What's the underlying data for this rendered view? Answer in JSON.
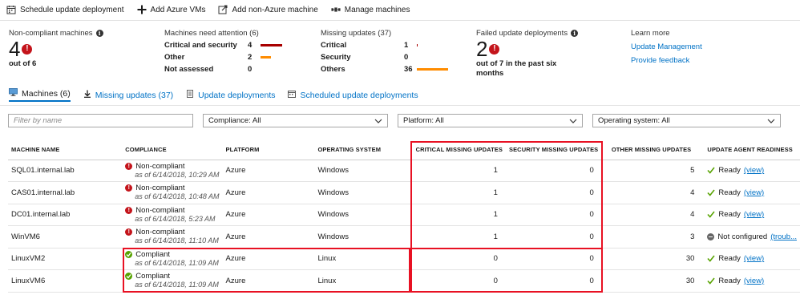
{
  "toolbar": {
    "schedule_label": "Schedule update deployment",
    "add_azure_label": "Add Azure VMs",
    "add_non_azure_label": "Add non-Azure machine",
    "manage_label": "Manage machines"
  },
  "summary": {
    "noncompliant": {
      "title": "Non-compliant machines",
      "value": "4",
      "sub": "out of 6"
    },
    "attention": {
      "title": "Machines need attention (6)",
      "rows": [
        {
          "label": "Critical and security",
          "value": "4",
          "bar_fraction": 0.67,
          "bar_color": "#a80000"
        },
        {
          "label": "Other",
          "value": "2",
          "bar_fraction": 0.33,
          "bar_color": "#ff8c00"
        },
        {
          "label": "Not assessed",
          "value": "0",
          "bar_fraction": 0,
          "bar_color": "#ff8c00"
        }
      ]
    },
    "missing": {
      "title": "Missing updates (37)",
      "rows": [
        {
          "label": "Critical",
          "value": "1",
          "bar_fraction": 0.03,
          "bar_color": "#a80000"
        },
        {
          "label": "Security",
          "value": "0",
          "bar_fraction": 0,
          "bar_color": "#a80000"
        },
        {
          "label": "Others",
          "value": "36",
          "bar_fraction": 0.97,
          "bar_color": "#ff8c00"
        }
      ]
    },
    "failed": {
      "title": "Failed update deployments",
      "value": "2",
      "sub": "out of 7 in the past six months"
    },
    "learn": {
      "title": "Learn more",
      "link1": "Update Management",
      "link2": "Provide feedback"
    }
  },
  "tabs": [
    {
      "label": "Machines (6)",
      "icon": "computer-icon"
    },
    {
      "label": "Missing updates (37)",
      "icon": "download-icon"
    },
    {
      "label": "Update deployments",
      "icon": "list-icon"
    },
    {
      "label": "Scheduled update deployments",
      "icon": "calendar-icon"
    }
  ],
  "filters": {
    "name_placeholder": "Filter by name",
    "compliance": "Compliance: All",
    "platform": "Platform: All",
    "os": "Operating system: All"
  },
  "table": {
    "headers": [
      "MACHINE NAME",
      "COMPLIANCE",
      "PLATFORM",
      "OPERATING SYSTEM",
      "CRITICAL MISSING UPDATES",
      "SECURITY MISSING UPDATES",
      "OTHER MISSING UPDATES",
      "UPDATE AGENT READINESS"
    ],
    "rows": [
      {
        "name": "SQL01.internal.lab",
        "status": "Non-compliant",
        "date": "as of 6/14/2018, 10:29 AM",
        "platform": "Azure",
        "os": "Windows",
        "critical": "1",
        "security": "0",
        "other": "5",
        "readiness": "Ready",
        "link": "(view)"
      },
      {
        "name": "CAS01.internal.lab",
        "status": "Non-compliant",
        "date": "as of 6/14/2018, 10:48 AM",
        "platform": "Azure",
        "os": "Windows",
        "critical": "1",
        "security": "0",
        "other": "4",
        "readiness": "Ready",
        "link": "(view)"
      },
      {
        "name": "DC01.internal.lab",
        "status": "Non-compliant",
        "date": "as of 6/14/2018, 5:23 AM",
        "platform": "Azure",
        "os": "Windows",
        "critical": "1",
        "security": "0",
        "other": "4",
        "readiness": "Ready",
        "link": "(view)"
      },
      {
        "name": "WinVM6",
        "status": "Non-compliant",
        "date": "as of 6/14/2018, 11:10 AM",
        "platform": "Azure",
        "os": "Windows",
        "critical": "1",
        "security": "0",
        "other": "3",
        "readiness": "Not configured",
        "link": "(troub..."
      },
      {
        "name": "LinuxVM2",
        "status": "Compliant",
        "date": "as of 6/14/2018, 11:09 AM",
        "platform": "Azure",
        "os": "Linux",
        "critical": "0",
        "security": "0",
        "other": "30",
        "readiness": "Ready",
        "link": "(view)"
      },
      {
        "name": "LinuxVM6",
        "status": "Compliant",
        "date": "as of 6/14/2018, 11:09 AM",
        "platform": "Azure",
        "os": "Linux",
        "critical": "0",
        "security": "0",
        "other": "30",
        "readiness": "Ready",
        "link": "(view)"
      }
    ]
  },
  "colors": {
    "accent": "#0072c6",
    "error": "#c4141b",
    "ok": "#57a300",
    "highlight": "#e81123"
  }
}
